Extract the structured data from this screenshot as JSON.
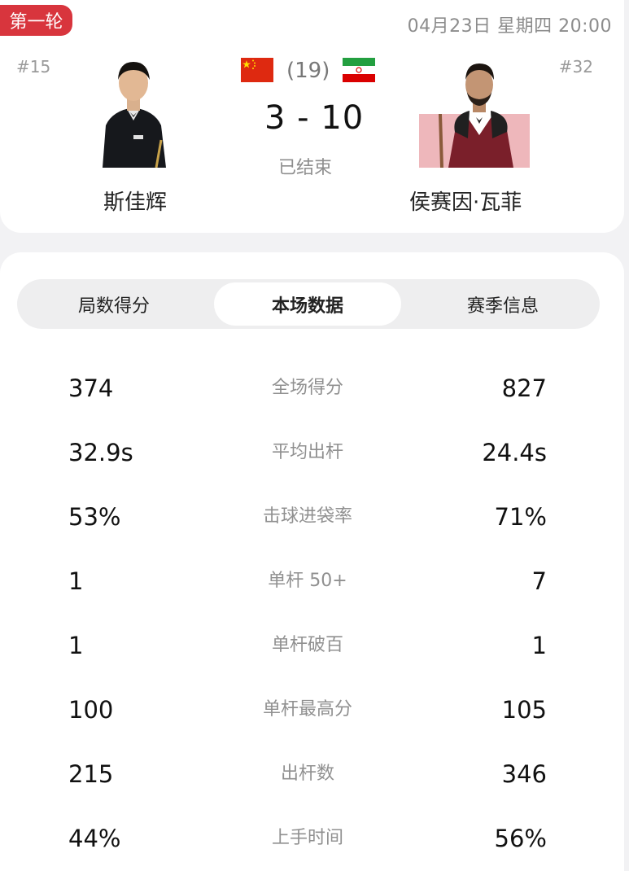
{
  "match": {
    "round": "第一轮",
    "datetime": "04月23日 星期四 20:00",
    "seed": "(19)",
    "score": "3 - 10",
    "status": "已结束",
    "colors": {
      "badge": "#d8353d"
    }
  },
  "player_left": {
    "rank": "#15",
    "name": "斯佳辉",
    "flag": "china-flag"
  },
  "player_right": {
    "rank": "#32",
    "name": "侯赛因·瓦菲",
    "flag": "iran-flag"
  },
  "tabs": [
    {
      "label": "局数得分"
    },
    {
      "label": "本场数据"
    },
    {
      "label": "赛季信息"
    }
  ],
  "active_tab": "本场数据",
  "stats": [
    {
      "label": "全场得分",
      "left": "374",
      "right": "827"
    },
    {
      "label": "平均出杆",
      "left": "32.9s",
      "right": "24.4s"
    },
    {
      "label": "击球进袋率",
      "left": "53%",
      "right": "71%"
    },
    {
      "label": "单杆 50+",
      "left": "1",
      "right": "7"
    },
    {
      "label": "单杆破百",
      "left": "1",
      "right": "1"
    },
    {
      "label": "单杆最高分",
      "left": "100",
      "right": "105"
    },
    {
      "label": "出杆数",
      "left": "215",
      "right": "346"
    },
    {
      "label": "上手时间",
      "left": "44%",
      "right": "56%"
    }
  ]
}
